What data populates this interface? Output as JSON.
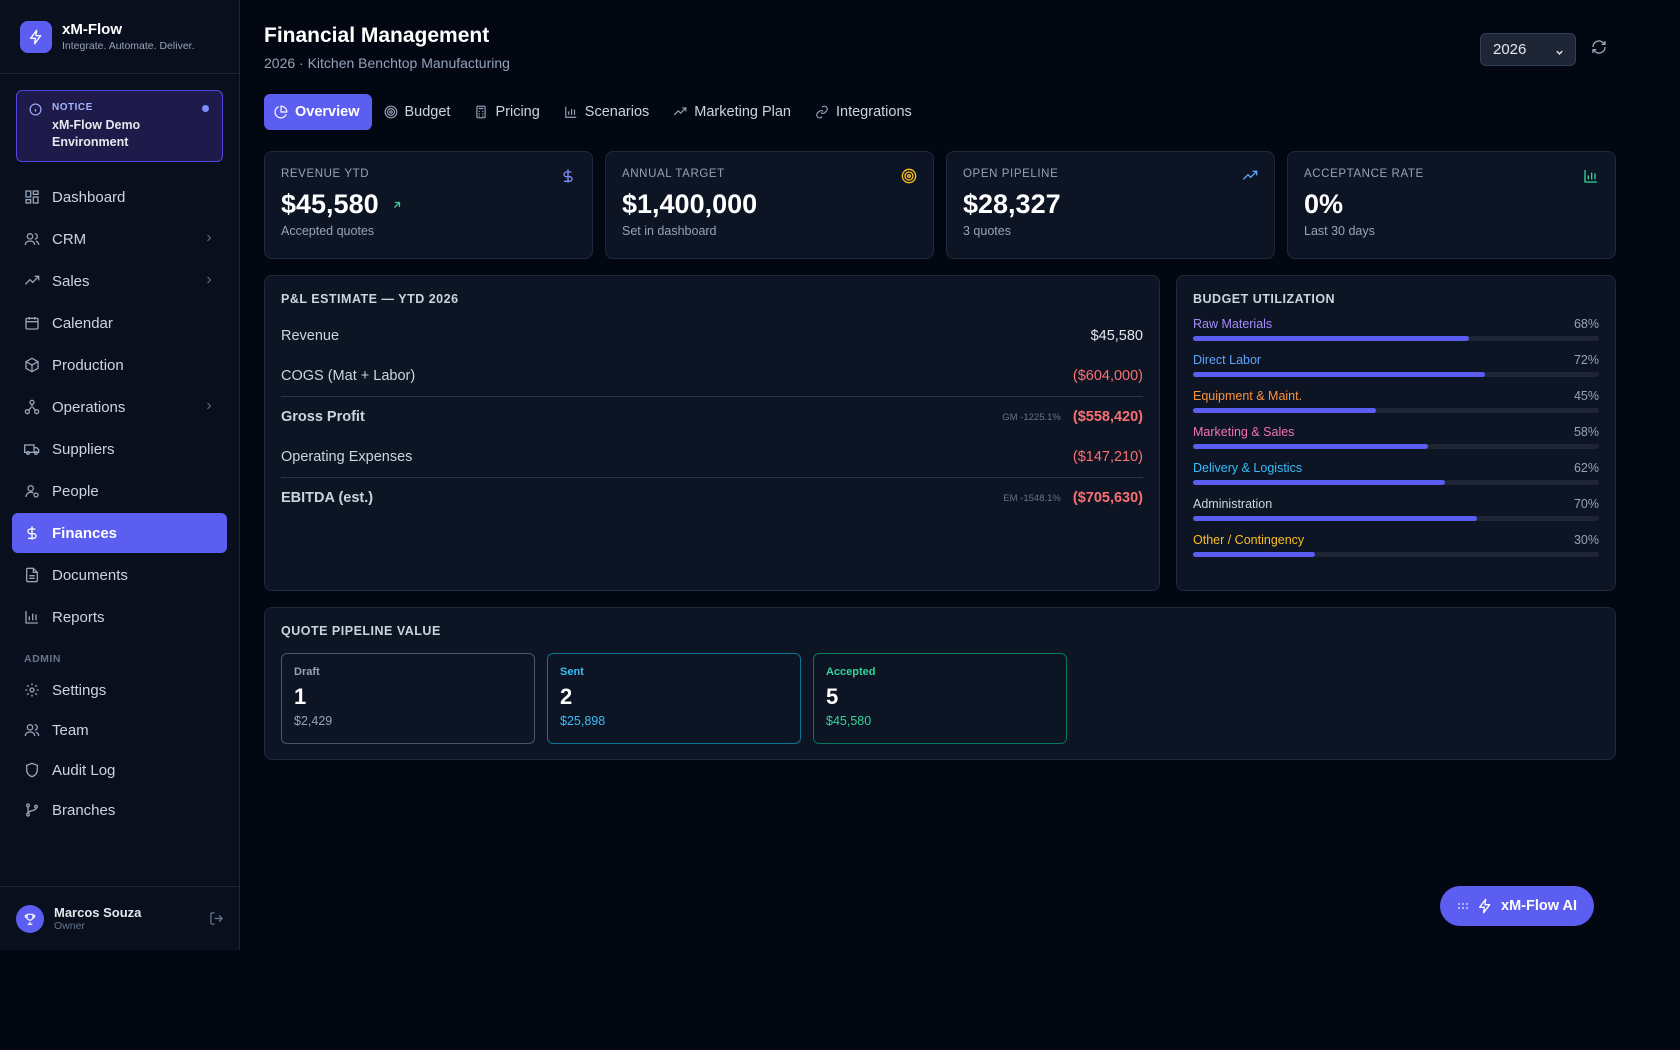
{
  "brand": {
    "name": "xM-Flow",
    "tagline": "Integrate. Automate. Deliver."
  },
  "notice": {
    "label": "NOTICE",
    "text": "xM-Flow Demo Environment"
  },
  "sidebar": {
    "items": [
      {
        "label": "Dashboard",
        "icon": "dashboard-icon"
      },
      {
        "label": "CRM",
        "icon": "users-icon",
        "expandable": true
      },
      {
        "label": "Sales",
        "icon": "trending-icon",
        "expandable": true
      },
      {
        "label": "Calendar",
        "icon": "calendar-icon"
      },
      {
        "label": "Production",
        "icon": "box-icon"
      },
      {
        "label": "Operations",
        "icon": "network-icon",
        "expandable": true
      },
      {
        "label": "Suppliers",
        "icon": "truck-icon"
      },
      {
        "label": "People",
        "icon": "person-icon"
      },
      {
        "label": "Finances",
        "icon": "dollar-icon",
        "active": true
      },
      {
        "label": "Documents",
        "icon": "document-icon"
      },
      {
        "label": "Reports",
        "icon": "bar-chart-icon"
      }
    ],
    "admin_label": "ADMIN",
    "admin_items": [
      {
        "label": "Settings",
        "icon": "gear-icon"
      },
      {
        "label": "Team",
        "icon": "team-icon"
      },
      {
        "label": "Audit Log",
        "icon": "shield-icon"
      },
      {
        "label": "Branches",
        "icon": "branch-icon"
      }
    ]
  },
  "user": {
    "name": "Marcos Souza",
    "role": "Owner"
  },
  "header": {
    "title": "Financial Management",
    "subtitle": "2026 · Kitchen Benchtop Manufacturing",
    "year": "2026"
  },
  "tabs": [
    {
      "label": "Overview",
      "active": true
    },
    {
      "label": "Budget"
    },
    {
      "label": "Pricing"
    },
    {
      "label": "Scenarios"
    },
    {
      "label": "Marketing Plan"
    },
    {
      "label": "Integrations"
    }
  ],
  "kpis": [
    {
      "label": "REVENUE YTD",
      "value": "$45,580",
      "sub": "Accepted quotes",
      "icon": "dollar-icon"
    },
    {
      "label": "ANNUAL TARGET",
      "value": "$1,400,000",
      "sub": "Set in dashboard",
      "icon": "target-icon"
    },
    {
      "label": "OPEN PIPELINE",
      "value": "$28,327",
      "sub": "3 quotes",
      "icon": "trending-up-icon"
    },
    {
      "label": "ACCEPTANCE RATE",
      "value": "0%",
      "sub": "Last 30 days",
      "icon": "bar-chart-icon"
    }
  ],
  "pl": {
    "title": "P&L ESTIMATE — YTD 2026",
    "revenue": {
      "label": "Revenue",
      "value": "$45,580"
    },
    "cogs": {
      "label": "COGS (Mat + Labor)",
      "value": "($604,000)"
    },
    "gross": {
      "label": "Gross Profit",
      "note": "GM -1225.1%",
      "value": "($558,420)"
    },
    "opex": {
      "label": "Operating Expenses",
      "value": "($147,210)"
    },
    "ebitda": {
      "label": "EBITDA (est.)",
      "note": "EM -1548.1%",
      "value": "($705,630)"
    }
  },
  "budget": {
    "title": "BUDGET UTILIZATION",
    "items": [
      {
        "label": "Raw Materials",
        "pct": "68%",
        "value": 68,
        "color": "#a78bfa"
      },
      {
        "label": "Direct Labor",
        "pct": "72%",
        "value": 72,
        "color": "#60a5fa"
      },
      {
        "label": "Equipment & Maint.",
        "pct": "45%",
        "value": 45,
        "color": "#fb923c"
      },
      {
        "label": "Marketing & Sales",
        "pct": "58%",
        "value": 58,
        "color": "#f472b6"
      },
      {
        "label": "Delivery & Logistics",
        "pct": "62%",
        "value": 62,
        "color": "#38bdf8"
      },
      {
        "label": "Administration",
        "pct": "70%",
        "value": 70,
        "color": "#cbd5e1"
      },
      {
        "label": "Other / Contingency",
        "pct": "30%",
        "value": 30,
        "color": "#fbbf24"
      }
    ]
  },
  "pipeline": {
    "title": "QUOTE PIPELINE VALUE",
    "stages": [
      {
        "label": "Draft",
        "count": "1",
        "amount": "$2,429",
        "color": "#94a3b8"
      },
      {
        "label": "Sent",
        "count": "2",
        "amount": "$25,898",
        "color": "#38bdf8"
      },
      {
        "label": "Accepted",
        "count": "5",
        "amount": "$45,580",
        "color": "#34d399"
      }
    ]
  },
  "ai_button": {
    "label": "xM-Flow AI"
  }
}
